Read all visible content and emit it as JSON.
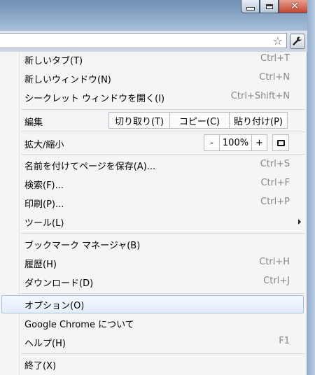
{
  "menu": {
    "new_tab": {
      "label": "新しいタブ(T)",
      "shortcut": "Ctrl+T"
    },
    "new_window": {
      "label": "新しいウィンドウ(N)",
      "shortcut": "Ctrl+N"
    },
    "incognito": {
      "label": "シークレット ウィンドウを開く(I)",
      "shortcut": "Ctrl+Shift+N"
    },
    "edit": {
      "label": "編集",
      "cut": "切り取り(T)",
      "copy": "コピー(C)",
      "paste": "貼り付け(P)"
    },
    "zoom": {
      "label": "拡大/縮小",
      "minus": "-",
      "value": "100%",
      "plus": "+"
    },
    "save_page": {
      "label": "名前を付けてページを保存(A)...",
      "shortcut": "Ctrl+S"
    },
    "find": {
      "label": "検索(F)...",
      "shortcut": "Ctrl+F"
    },
    "print": {
      "label": "印刷(P)...",
      "shortcut": "Ctrl+P"
    },
    "tools": {
      "label": "ツール(L)"
    },
    "bookmark_manager": {
      "label": "ブックマーク マネージャ(B)"
    },
    "history": {
      "label": "履歴(H)",
      "shortcut": "Ctrl+H"
    },
    "downloads": {
      "label": "ダウンロード(D)",
      "shortcut": "Ctrl+J"
    },
    "options": {
      "label": "オプション(O)"
    },
    "about": {
      "label": "Google Chrome について"
    },
    "help": {
      "label": "ヘルプ(H)",
      "shortcut": "F1"
    },
    "exit": {
      "label": "終了(X)"
    }
  },
  "icons": {
    "star": "bookmark-star-icon",
    "wrench": "wrench-icon"
  },
  "colors": {
    "highlight_border": "#9fbde5",
    "menu_bg": "#f4f5f6"
  }
}
